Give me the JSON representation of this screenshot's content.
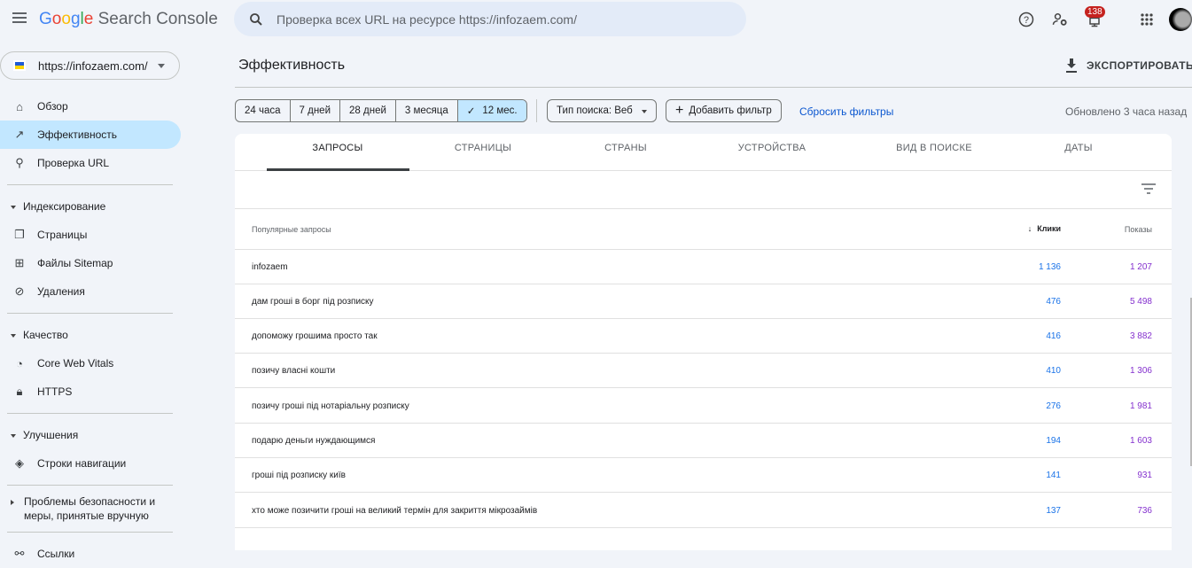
{
  "app": {
    "logo_google": "Google",
    "logo_product": "Search Console"
  },
  "search": {
    "placeholder": "Проверка всех URL на ресурсе https://infozaem.com/"
  },
  "header": {
    "notifications_count": "138"
  },
  "property": {
    "url": "https://infozaem.com/"
  },
  "sidebar": {
    "items": [
      {
        "label": "Обзор",
        "icon": "home-icon"
      },
      {
        "label": "Эффективность",
        "icon": "trending-icon"
      },
      {
        "label": "Проверка URL",
        "icon": "search-icon"
      }
    ],
    "sections": [
      {
        "label": "Индексирование",
        "items": [
          {
            "label": "Страницы"
          },
          {
            "label": "Файлы Sitemap"
          },
          {
            "label": "Удаления"
          }
        ]
      },
      {
        "label": "Качество",
        "items": [
          {
            "label": "Core Web Vitals"
          },
          {
            "label": "HTTPS"
          }
        ]
      },
      {
        "label": "Улучшения",
        "items": [
          {
            "label": "Строки навигации"
          }
        ]
      },
      {
        "label": "Проблемы безопасности и меры, принятые вручную"
      },
      {
        "label": "Ссылки"
      }
    ]
  },
  "page": {
    "title": "Эффективность",
    "export": "ЭКСПОРТИРОВАТЬ",
    "updated": "Обновлено 3 часа назад"
  },
  "filters": {
    "dates": [
      "24 часа",
      "7 дней",
      "28 дней",
      "3 месяца",
      "12 мес."
    ],
    "selected": "12 мес.",
    "search_type": "Тип поиска: Веб",
    "add_filter": "Добавить фильтр",
    "reset": "Сбросить фильтры"
  },
  "tabs": [
    "ЗАПРОСЫ",
    "СТРАНИЦЫ",
    "СТРАНЫ",
    "УСТРОЙСТВА",
    "ВИД В ПОИСКЕ",
    "ДАТЫ"
  ],
  "table": {
    "headers": {
      "query": "Популярные запросы",
      "clicks": "Клики",
      "impressions": "Показы"
    },
    "rows": [
      {
        "q": "infozaem",
        "c": "1 136",
        "i": "1 207"
      },
      {
        "q": "дам гроші в борг під розписку",
        "c": "476",
        "i": "5 498"
      },
      {
        "q": "допоможу грошима просто так",
        "c": "416",
        "i": "3 882"
      },
      {
        "q": "позичу власні кошти",
        "c": "410",
        "i": "1 306"
      },
      {
        "q": "позичу гроші під нотаріальну розписку",
        "c": "276",
        "i": "1 981"
      },
      {
        "q": "подарю деньги нуждающимся",
        "c": "194",
        "i": "1 603"
      },
      {
        "q": "гроші під розписку київ",
        "c": "141",
        "i": "931"
      },
      {
        "q": "хто може позичити гроші на великий термін для закриття мікрозаймів",
        "c": "137",
        "i": "736"
      }
    ]
  }
}
